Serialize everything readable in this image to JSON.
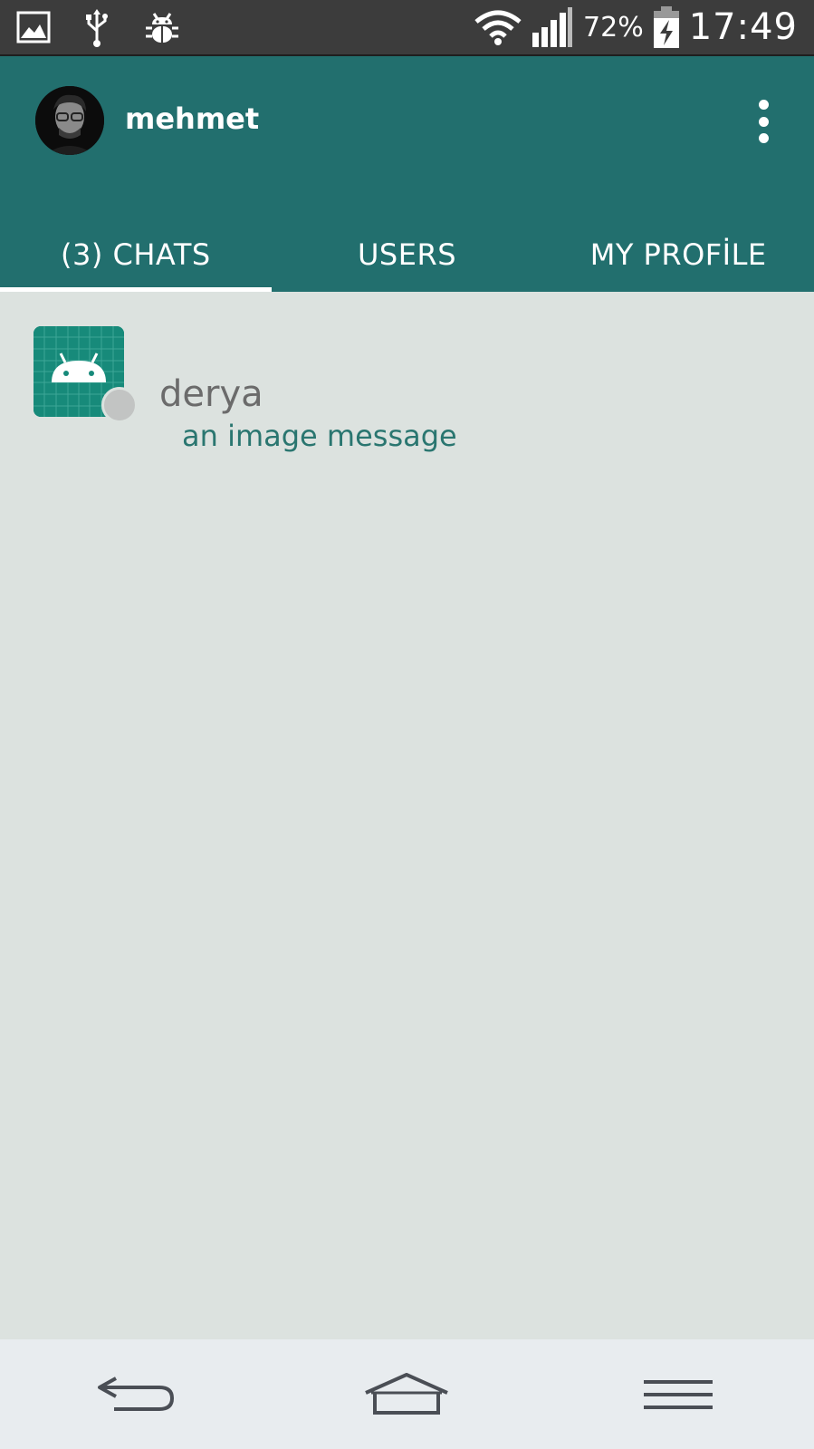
{
  "status_bar": {
    "battery_percent": "72%",
    "time": "17:49",
    "icons": [
      "image-icon",
      "usb-icon",
      "bug-icon",
      "wifi-icon",
      "signal-icon",
      "battery-charging-icon"
    ]
  },
  "toolbar": {
    "user_name": "mehmet",
    "menu_icon": "more-vertical-icon"
  },
  "tabs": [
    {
      "label": "(3) CHATS",
      "active": true
    },
    {
      "label": "USERS",
      "active": false
    },
    {
      "label": "MY PROFİLE",
      "active": false
    }
  ],
  "chats": [
    {
      "name": "derya",
      "last_message": "an image message",
      "online": false
    }
  ],
  "nav_bar": {
    "icons": [
      "back-icon",
      "home-icon",
      "menu-icon"
    ]
  },
  "colors": {
    "primary": "#226f6e",
    "background": "#dce2df",
    "accent_text": "#2a7670",
    "status_bar": "#3c3c3c"
  }
}
